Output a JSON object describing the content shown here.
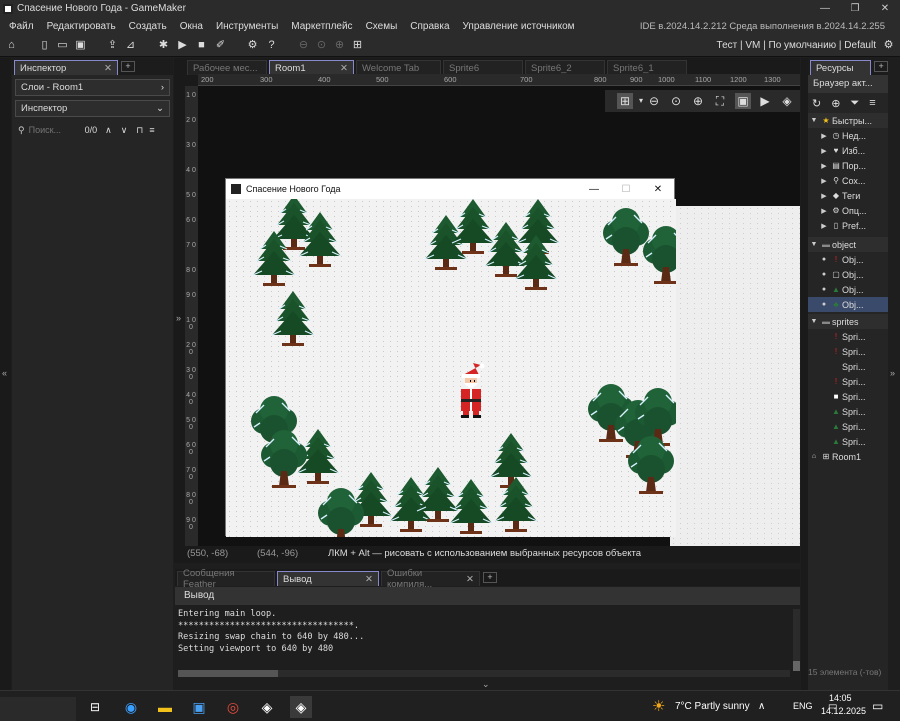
{
  "window": {
    "title": "Спасение Нового Года - GameMaker",
    "controls": [
      "—",
      "❐",
      "✕"
    ]
  },
  "menu": {
    "items": [
      "Файл",
      "Редактировать",
      "Создать",
      "Окна",
      "Инструменты",
      "Маркетплейс",
      "Схемы",
      "Справка",
      "Управление источником"
    ],
    "version": "IDE в.2024.14.2.212  Среда выполнения в.2024.14.2.255"
  },
  "toolbar": {
    "right": "Тест  |  VM  |  По умолчанию  |  Default"
  },
  "left_panel": {
    "tab": "Инспектор",
    "layers": "Слои - Room1",
    "inspector": "Инспектор",
    "search_placeholder": "Поиск...",
    "count": "0/0"
  },
  "editor": {
    "tabs": [
      "Рабочее мес...",
      "Room1",
      "Welcome Tab",
      "Sprite6",
      "Sprite6_2",
      "Sprite6_1"
    ],
    "active_tab": "Room1",
    "ruler_h": [
      "200",
      "300",
      "400",
      "500",
      "600",
      "700",
      "800",
      "900",
      "1000",
      "1100",
      "1200",
      "1300",
      "1400"
    ],
    "ruler_v": [
      "1 0",
      "2 0",
      "3 0",
      "4 0",
      "5 0",
      "6 0",
      "7 0",
      "8 0",
      "9 0",
      "1 0 0",
      "2 0 0",
      "3 0 0",
      "4 0 0",
      "5 0 0",
      "6 0 0",
      "7 0 0",
      "8 0 0",
      "9 0 0"
    ],
    "status": {
      "pos1": "(550, -68)",
      "pos2": "(544, -96)",
      "hint": "ЛКМ + Alt — рисовать с использованием выбранных ресурсов объекта"
    }
  },
  "game_window": {
    "title": "Спасение Нового Года",
    "controls": [
      "—",
      "☐",
      "✕"
    ]
  },
  "bottom": {
    "tabs": [
      "Сообщения Feather",
      "Вывод",
      "Ошибки компиля..."
    ],
    "active_tab": "Вывод",
    "header": "Вывод",
    "lines": [
      "Entering main loop.",
      "**********************************.",
      "Resizing swap chain to 640 by 480...",
      "Setting viewport to 640 by 480"
    ]
  },
  "right_panel": {
    "tab": "Ресурсы",
    "browser": "Браузер акт...",
    "quick": {
      "label": "Быстры...",
      "items": [
        "Нед...",
        "Изб...",
        "Пор...",
        "Сох...",
        "Теги",
        "Опц...",
        "Pref..."
      ]
    },
    "object_group": "object",
    "objects": [
      "Obj...",
      "Obj...",
      "Obj...",
      "Obj..."
    ],
    "sprites_group": "sprites",
    "sprites": [
      "Spri...",
      "Spri...",
      "Spri...",
      "Spri...",
      "Spri...",
      "Spri...",
      "Spri...",
      "Spri..."
    ],
    "room": "Room1",
    "footer": "15 элемента (-тов)"
  },
  "taskbar": {
    "weather": "7°C  Partly sunny",
    "lang": "ENG",
    "time": "14:05",
    "date": "14.12.2025"
  }
}
